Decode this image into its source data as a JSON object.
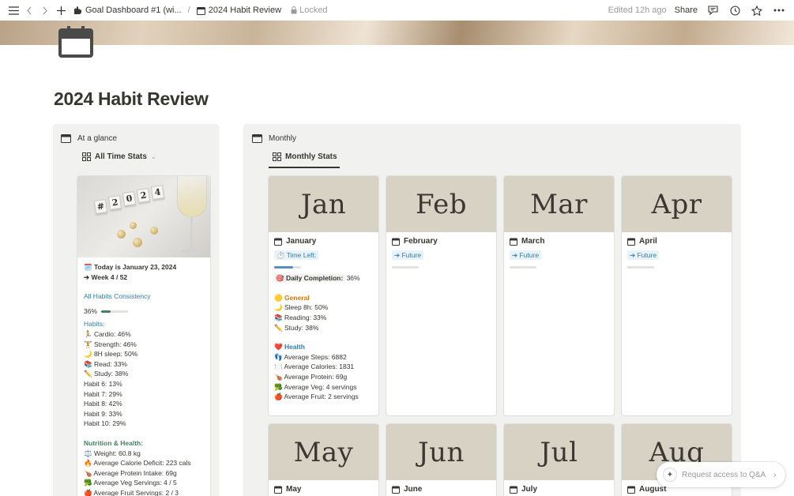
{
  "topbar": {
    "workspace": "Goal Dashboard #1 (wi...",
    "separator": "/",
    "page": "2024 Habit Review",
    "locked": "Locked",
    "edited": "Edited 12h ago",
    "share": "Share"
  },
  "page": {
    "title": "2024 Habit Review"
  },
  "glance": {
    "header": "At a glance",
    "view": "All Time Stats",
    "image_tiles": [
      "#",
      "2",
      "0",
      "2",
      "4"
    ],
    "today": "🗓️ Today is January 23, 2024",
    "week": "➔ Week 4 / 52",
    "consistency_label": "All Habits Consistency",
    "consistency_value": "36%",
    "consistency_fraction": 0.36,
    "habits_label": "Habits:",
    "habits": [
      "🏃 Cardio: 46%",
      "🏋️ Strength: 46%",
      "🌙 8H sleep: 50%",
      "📚 Read: 33%",
      "✏️ Study: 38%",
      "Habit 6: 13%",
      "Habit 7: 29%",
      "Habit 8: 42%",
      "Habit 9: 33%",
      "Habit 10: 29%"
    ],
    "nutrition_label": "Nutrition & Health:",
    "nutrition": [
      "⚖️ Weight: 60.8 kg",
      "🔥 Average Calorie Deficit: 223 cals",
      "🍗 Average Protein Intake: 69g",
      "🥦 Average Veg Servings: 4 / 5",
      "🍎 Average Fruit Servings: 2 / 3"
    ]
  },
  "monthly": {
    "header": "Monthly",
    "view": "Monthly Stats",
    "months": [
      {
        "cover": "Jan",
        "name": "January"
      },
      {
        "cover": "Feb",
        "name": "February",
        "tag": "➔ Future"
      },
      {
        "cover": "Mar",
        "name": "March",
        "tag": "➔ Future"
      },
      {
        "cover": "Apr",
        "name": "April",
        "tag": "➔ Future"
      },
      {
        "cover": "May",
        "name": "May"
      },
      {
        "cover": "Jun",
        "name": "June"
      },
      {
        "cover": "Jul",
        "name": "July"
      },
      {
        "cover": "Aug",
        "name": "August"
      }
    ],
    "january": {
      "time_left": "⏱️ Time Left:",
      "time_left_fraction": 0.7,
      "daily_completion_label": "🎯 Daily Completion:",
      "daily_completion_value": "36%",
      "general_label": "🟡 General",
      "general": [
        "🌙 Sleep 8h: 50%",
        "📚 Reading: 33%",
        "✏️ Study: 38%"
      ],
      "health_label": "❤️ Health",
      "health": [
        "👣 Average Steps: 6882",
        "🍽️ Average Calories: 1831",
        "🍗 Average Protein: 69g",
        "🥦 Average Veg: 4 servings",
        "🍎 Average Fruit: 2 servings"
      ]
    }
  },
  "qa": {
    "label": "Request access to Q&A"
  }
}
